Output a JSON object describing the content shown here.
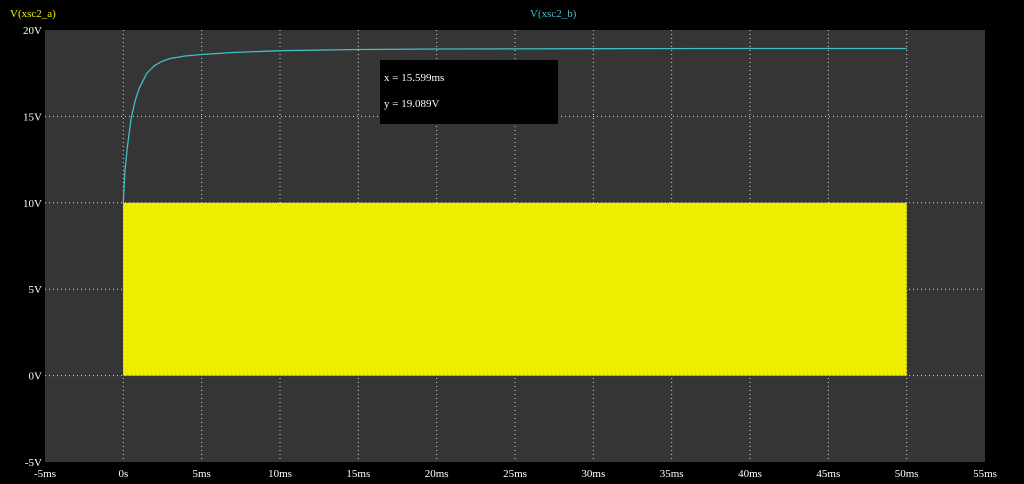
{
  "colors": {
    "background": "#000000",
    "plot_area": "#353535",
    "grid": "#d9d9d9",
    "tick_text": "#ffffff",
    "series_a": "#f2f200",
    "series_b": "#3fbfc7"
  },
  "cursor": {
    "x_text": "x = 15.599ms",
    "y_text": "y = 19.089V"
  },
  "chart_data": {
    "type": "line",
    "title": "",
    "xlabel": "",
    "ylabel": "",
    "xlim": [
      -5,
      55
    ],
    "ylim": [
      -5,
      20
    ],
    "x_unit": "ms",
    "y_unit": "V",
    "grid": true,
    "xticks": [
      -5,
      0,
      5,
      10,
      15,
      20,
      25,
      30,
      35,
      40,
      45,
      50,
      55
    ],
    "xtick_labels": [
      "-5ms",
      "0s",
      "5ms",
      "10ms",
      "15ms",
      "20ms",
      "25ms",
      "30ms",
      "35ms",
      "40ms",
      "45ms",
      "50ms",
      "55ms"
    ],
    "yticks": [
      -5,
      0,
      5,
      10,
      15,
      20
    ],
    "ytick_labels": [
      "-5V",
      "0V",
      "5V",
      "10V",
      "15V",
      "20V"
    ],
    "series": [
      {
        "name": "V(xsc2_a)",
        "color": "#f2f200",
        "kind": "square_wave",
        "low": 0,
        "high": 10,
        "t_start": 0,
        "t_end": 50
      },
      {
        "name": "V(xsc2_b)",
        "color": "#3fbfc7",
        "kind": "line",
        "x": [
          0,
          0.1,
          0.25,
          0.5,
          0.75,
          1,
          1.5,
          2,
          2.5,
          3,
          4,
          5,
          7,
          10,
          15,
          20,
          30,
          40,
          50
        ],
        "y": [
          10,
          11.8,
          13.2,
          14.9,
          15.9,
          16.6,
          17.5,
          17.95,
          18.2,
          18.35,
          18.5,
          18.58,
          18.7,
          18.8,
          18.87,
          18.9,
          18.92,
          18.93,
          18.93
        ]
      }
    ]
  }
}
